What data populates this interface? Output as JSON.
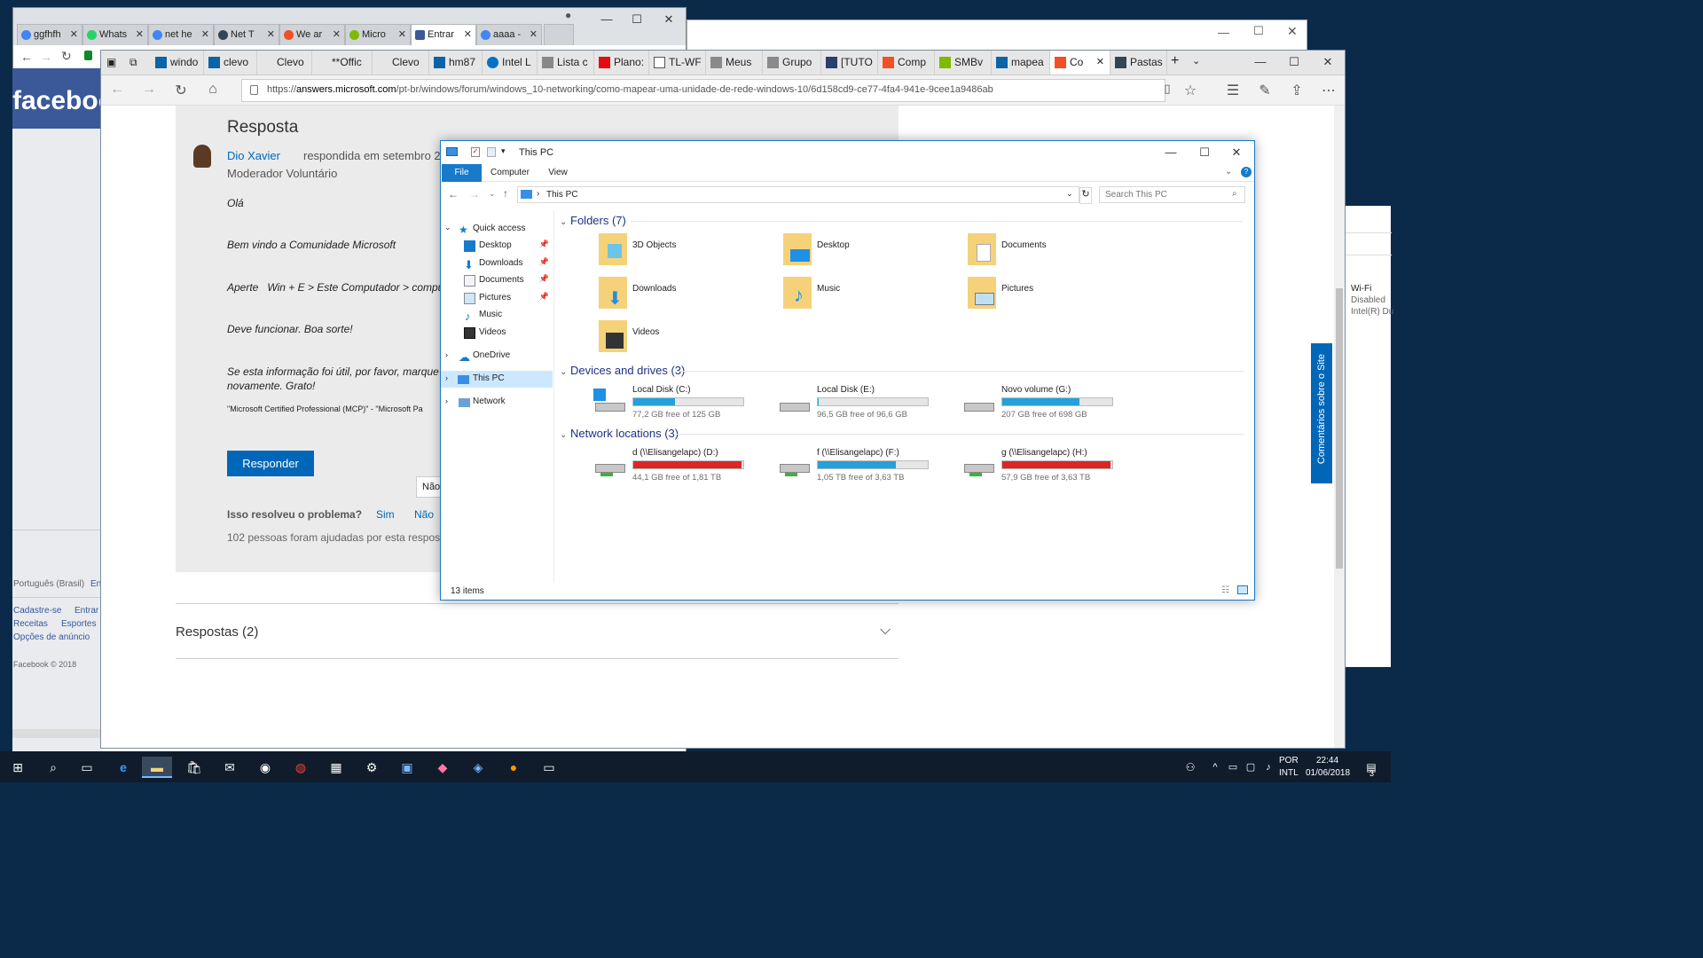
{
  "chrome": {
    "tabs": [
      "ggfhfh",
      "Whats",
      "net he",
      "Net T",
      "We ar",
      "Micro",
      "Entrar",
      "aaaa -"
    ],
    "facebook_logo": "faceboo",
    "footer": {
      "language": "Português (Brasil)",
      "lang2": "En",
      "links": [
        "Cadastre-se",
        "Entrar",
        "Receitas",
        "Esportes",
        "Opções de anúncio"
      ],
      "copyright": "Facebook © 2018"
    }
  },
  "edge": {
    "tabs": [
      "windo",
      "clevo",
      "Clevo",
      "**Offic",
      "Clevo",
      "hm87",
      "Intel L",
      "Lista c",
      "Plano:",
      "TL-WF",
      "Meus",
      "Grupo",
      "[TUTO",
      "Comp",
      "SMBv",
      "mapea",
      "Co",
      "Pastas"
    ],
    "url_prefix": "https://",
    "url_host": "answers.microsoft.com",
    "url_path": "/pt-br/windows/forum/windows_10-networking/como-mapear-uma-unidade-de-rede-windows-10/6d158cd9-ce77-4fa4-941e-9cee1a9486ab"
  },
  "page": {
    "heading": "Resposta",
    "author": "Dio Xavier",
    "answered": "respondida em setembro 22, 2015",
    "role": "Moderador Voluntário",
    "lines": [
      "Olá",
      "Bem vindo a Comunidade Microsoft",
      "Aperte   Win + E > Este Computador > compu",
      "Deve funcionar. Boa sorte!",
      "Se esta informação foi útil, por favor, marque",
      "novamente. Grato!"
    ],
    "signature": "\"Microsoft Certified Professional (MCP)\" - \"Microsoft Pa",
    "reply_button": "Responder",
    "no_button": "Não",
    "resolved_q": "Isso resolveu o problema?",
    "yes": "Sim",
    "no": "Não",
    "helped": "102 pessoas foram ajudadas por esta respos",
    "answers_title": "Respostas (2)",
    "feedback_tab": "Comentários sobre o Site"
  },
  "right_panel": {
    "wifi": "Wi-Fi",
    "status": "Disabled",
    "adapter": "Intel(R) Du"
  },
  "explorer": {
    "title": "This PC",
    "ribbon_tabs": [
      "File",
      "Computer",
      "View"
    ],
    "breadcrumb": "This PC",
    "search_placeholder": "Search This PC",
    "nav": {
      "quick_access": "Quick access",
      "quick_items": [
        "Desktop",
        "Downloads",
        "Documents",
        "Pictures",
        "Music",
        "Videos"
      ],
      "onedrive": "OneDrive",
      "this_pc": "This PC",
      "network": "Network"
    },
    "folders_header": "Folders (7)",
    "folders": [
      "3D Objects",
      "Desktop",
      "Documents",
      "Downloads",
      "Music",
      "Pictures",
      "Videos"
    ],
    "devices_header": "Devices and drives (3)",
    "drives": [
      {
        "name": "Local Disk (C:)",
        "free": "77,2 GB free of 125 GB",
        "used_fraction": 0.38,
        "color": "#26a0da"
      },
      {
        "name": "Local Disk (E:)",
        "free": "96,5 GB free of 96,6 GB",
        "used_fraction": 0.01,
        "color": "#26a0da"
      },
      {
        "name": "Novo volume (G:)",
        "free": "207 GB free of 698 GB",
        "used_fraction": 0.7,
        "color": "#26a0da"
      }
    ],
    "network_header": "Network locations (3)",
    "network_drives": [
      {
        "name": "d (\\\\Elisangelapc) (D:)",
        "free": "44,1 GB free of 1,81 TB",
        "used_fraction": 0.98,
        "color": "#da2626"
      },
      {
        "name": "f (\\\\Elisangelapc) (F:)",
        "free": "1,05 TB free of 3,63 TB",
        "used_fraction": 0.71,
        "color": "#26a0da"
      },
      {
        "name": "g (\\\\Elisangelapc) (H:)",
        "free": "57,9 GB free of 3,63 TB",
        "used_fraction": 0.98,
        "color": "#da2626"
      }
    ],
    "status": "13 items"
  },
  "taskbar": {
    "lang": "POR",
    "layout": "INTL",
    "time": "22:44",
    "date": "01/06/2018",
    "notif": "3"
  }
}
